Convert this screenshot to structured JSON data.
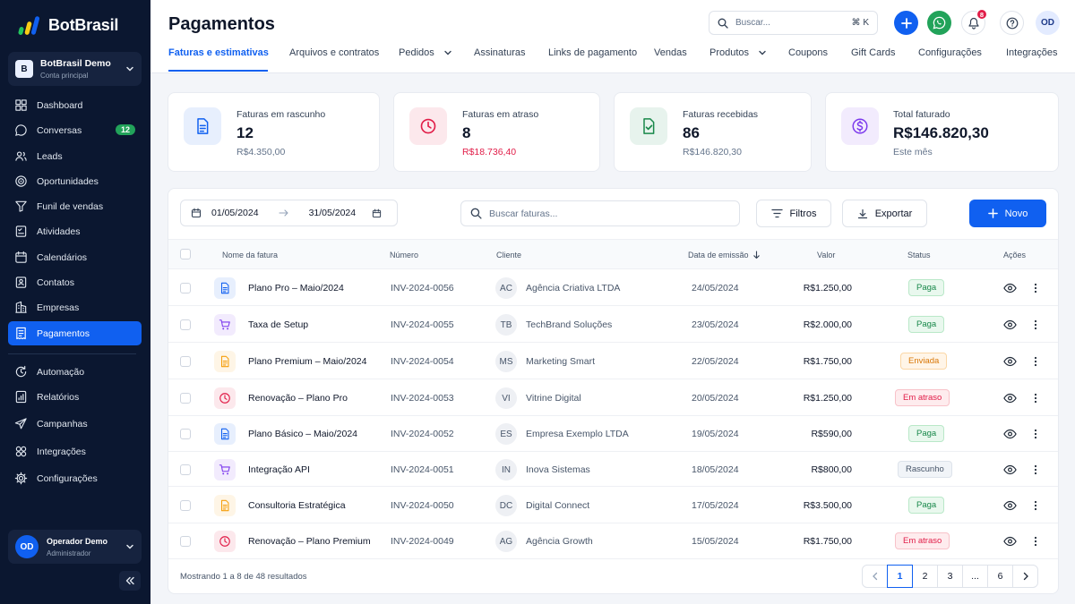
{
  "app": {
    "logo_text": "BotBrasil"
  },
  "account": {
    "badge": "B",
    "name": "BotBrasil Demo",
    "subtitle": "Conta principal"
  },
  "sidebar": {
    "items": [
      {
        "label": "Dashboard",
        "icon": "dashboard-icon"
      },
      {
        "label": "Conversas",
        "icon": "chat-icon",
        "badge": "12"
      },
      {
        "label": "Leads",
        "icon": "leads-icon"
      },
      {
        "label": "Oportunidades",
        "icon": "target-icon"
      },
      {
        "label": "Funil de vendas",
        "icon": "funnel-icon"
      },
      {
        "label": "Atividades",
        "icon": "checklist-icon"
      },
      {
        "label": "Calendários",
        "icon": "calendar-icon"
      },
      {
        "label": "Contatos",
        "icon": "contacts-icon"
      },
      {
        "label": "Empresas",
        "icon": "building-icon"
      },
      {
        "label": "Pagamentos",
        "icon": "receipt-icon",
        "active": true
      },
      {
        "label": "Automação",
        "icon": "automation-icon"
      },
      {
        "label": "Relatórios",
        "icon": "report-icon"
      },
      {
        "label": "Campanhas",
        "icon": "send-icon"
      },
      {
        "label": "Integrações",
        "icon": "integrations-icon"
      },
      {
        "label": "Configurações",
        "icon": "gear-icon"
      }
    ]
  },
  "user": {
    "initials": "OD",
    "name": "Operador Demo",
    "role": "Administrador"
  },
  "header": {
    "title": "Pagamentos",
    "search_placeholder": "Buscar...",
    "search_shortcut": "⌘ K",
    "notifications_count": "8",
    "avatar_initials": "OD"
  },
  "tabs": [
    {
      "label": "Faturas e estimativas",
      "active": true
    },
    {
      "label": "Arquivos e contratos"
    },
    {
      "label": "Pedidos",
      "dropdown": true
    },
    {
      "label": "Assinaturas"
    },
    {
      "label": "Links de pagamento"
    },
    {
      "label": "Vendas"
    },
    {
      "label": "Produtos",
      "dropdown": true
    },
    {
      "label": "Coupons"
    },
    {
      "label": "Gift Cards"
    },
    {
      "label": "Configurações"
    },
    {
      "label": "Integrações"
    }
  ],
  "stats": [
    {
      "label": "Faturas em rascunho",
      "value": "12",
      "sub": "R$4.350,00",
      "color": "#1060f0",
      "icon": "document-icon"
    },
    {
      "label": "Faturas em atraso",
      "value": "8",
      "sub": "R$18.736,40",
      "color": "#e11d48",
      "icon": "clock-icon"
    },
    {
      "label": "Faturas recebidas",
      "value": "86",
      "sub": "R$146.820,30",
      "color": "#18884a",
      "icon": "check-document-icon"
    },
    {
      "label": "Total faturado",
      "value": "R$146.820,30",
      "sub": "Este mês",
      "color": "#7c3aed",
      "icon": "dollar-coin-icon"
    }
  ],
  "filters": {
    "date_from": "01/05/2024",
    "date_to": "31/05/2024",
    "search_placeholder": "Buscar faturas...",
    "filters_label": "Filtros",
    "export_label": "Exportar",
    "new_label": "Novo"
  },
  "table": {
    "columns": {
      "name": "Nome da fatura",
      "number": "Número",
      "client": "Cliente",
      "date": "Data de emissão",
      "value": "Valor",
      "status": "Status",
      "actions": "Ações"
    },
    "rows": [
      {
        "name": "Plano Pro – Maio/2024",
        "number": "INV-2024-0056",
        "initials": "AC",
        "client": "Agência Criativa LTDA",
        "date": "24/05/2024",
        "value": "R$1.250,00",
        "status": "Paga",
        "status_type": "paga",
        "icon": "document-icon",
        "icon_color": "#1060f0"
      },
      {
        "name": "Taxa de Setup",
        "number": "INV-2024-0055",
        "initials": "TB",
        "client": "TechBrand Soluções",
        "date": "23/05/2024",
        "value": "R$2.000,00",
        "status": "Paga",
        "status_type": "paga",
        "icon": "cart-icon",
        "icon_color": "#7c3aed"
      },
      {
        "name": "Plano Premium – Maio/2024",
        "number": "INV-2024-0054",
        "initials": "MS",
        "client": "Marketing Smart",
        "date": "22/05/2024",
        "value": "R$1.750,00",
        "status": "Enviada",
        "status_type": "enviada",
        "icon": "document-icon",
        "icon_color": "#f59e0b"
      },
      {
        "name": "Renovação – Plano Pro",
        "number": "INV-2024-0053",
        "initials": "VI",
        "client": "Vitrine Digital",
        "date": "20/05/2024",
        "value": "R$1.250,00",
        "status": "Em atraso",
        "status_type": "atraso",
        "icon": "clock-icon",
        "icon_color": "#e11d48"
      },
      {
        "name": "Plano Básico – Maio/2024",
        "number": "INV-2024-0052",
        "initials": "ES",
        "client": "Empresa Exemplo LTDA",
        "date": "19/05/2024",
        "value": "R$590,00",
        "status": "Paga",
        "status_type": "paga",
        "icon": "document-icon",
        "icon_color": "#1060f0"
      },
      {
        "name": "Integração API",
        "number": "INV-2024-0051",
        "initials": "IN",
        "client": "Inova Sistemas",
        "date": "18/05/2024",
        "value": "R$800,00",
        "status": "Rascunho",
        "status_type": "rascunho",
        "icon": "cart-icon",
        "icon_color": "#7c3aed"
      },
      {
        "name": "Consultoria Estratégica",
        "number": "INV-2024-0050",
        "initials": "DC",
        "client": "Digital Connect",
        "date": "17/05/2024",
        "value": "R$3.500,00",
        "status": "Paga",
        "status_type": "paga",
        "icon": "document-icon",
        "icon_color": "#f59e0b"
      },
      {
        "name": "Renovação – Plano Premium",
        "number": "INV-2024-0049",
        "initials": "AG",
        "client": "Agência Growth",
        "date": "15/05/2024",
        "value": "R$1.750,00",
        "status": "Em atraso",
        "status_type": "atraso",
        "icon": "clock-icon",
        "icon_color": "#e11d48"
      }
    ]
  },
  "footer": {
    "summary": "Mostrando 1 a 8 de 48 resultados",
    "pages": [
      "1",
      "2",
      "3",
      "...",
      "6"
    ],
    "current_page": "1"
  }
}
